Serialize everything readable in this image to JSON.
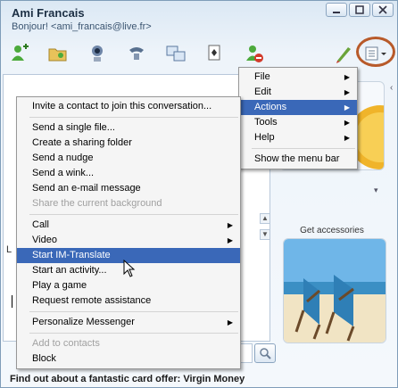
{
  "window": {
    "title": "Ami Francais",
    "status": "Bonjour! <ami_francais@live.fr>"
  },
  "sidebar": {
    "accessories_label": "Get accessories"
  },
  "ad": {
    "text": "Find out about a fantastic card offer: Virgin Money"
  },
  "main_menu": {
    "items": [
      {
        "label": "File",
        "submenu": true
      },
      {
        "label": "Edit",
        "submenu": true
      },
      {
        "label": "Actions",
        "submenu": true,
        "highlight": true
      },
      {
        "label": "Tools",
        "submenu": true
      },
      {
        "label": "Help",
        "submenu": true
      }
    ],
    "show_menu_bar": "Show the menu bar"
  },
  "actions_menu": {
    "group1": [
      "Invite a contact to join this conversation..."
    ],
    "group2": [
      {
        "label": "Send a single file..."
      },
      {
        "label": "Create a sharing folder"
      },
      {
        "label": "Send a nudge"
      },
      {
        "label": "Send a wink..."
      },
      {
        "label": "Send an e-mail message"
      },
      {
        "label": "Share the current background",
        "disabled": true
      }
    ],
    "group3": [
      {
        "label": "Call",
        "submenu": true
      },
      {
        "label": "Video",
        "submenu": true
      },
      {
        "label": "Start IM-Translate",
        "highlight": true
      },
      {
        "label": "Start an activity..."
      },
      {
        "label": "Play a game"
      },
      {
        "label": "Request remote assistance"
      }
    ],
    "group4": [
      {
        "label": "Personalize Messenger",
        "submenu": true
      }
    ],
    "group5": [
      {
        "label": "Add to contacts",
        "disabled": true
      },
      {
        "label": "Block"
      }
    ]
  },
  "left_glyph": "L",
  "colors": {
    "highlight": "#3a68b8",
    "accent_ring": "#b85a2a"
  }
}
